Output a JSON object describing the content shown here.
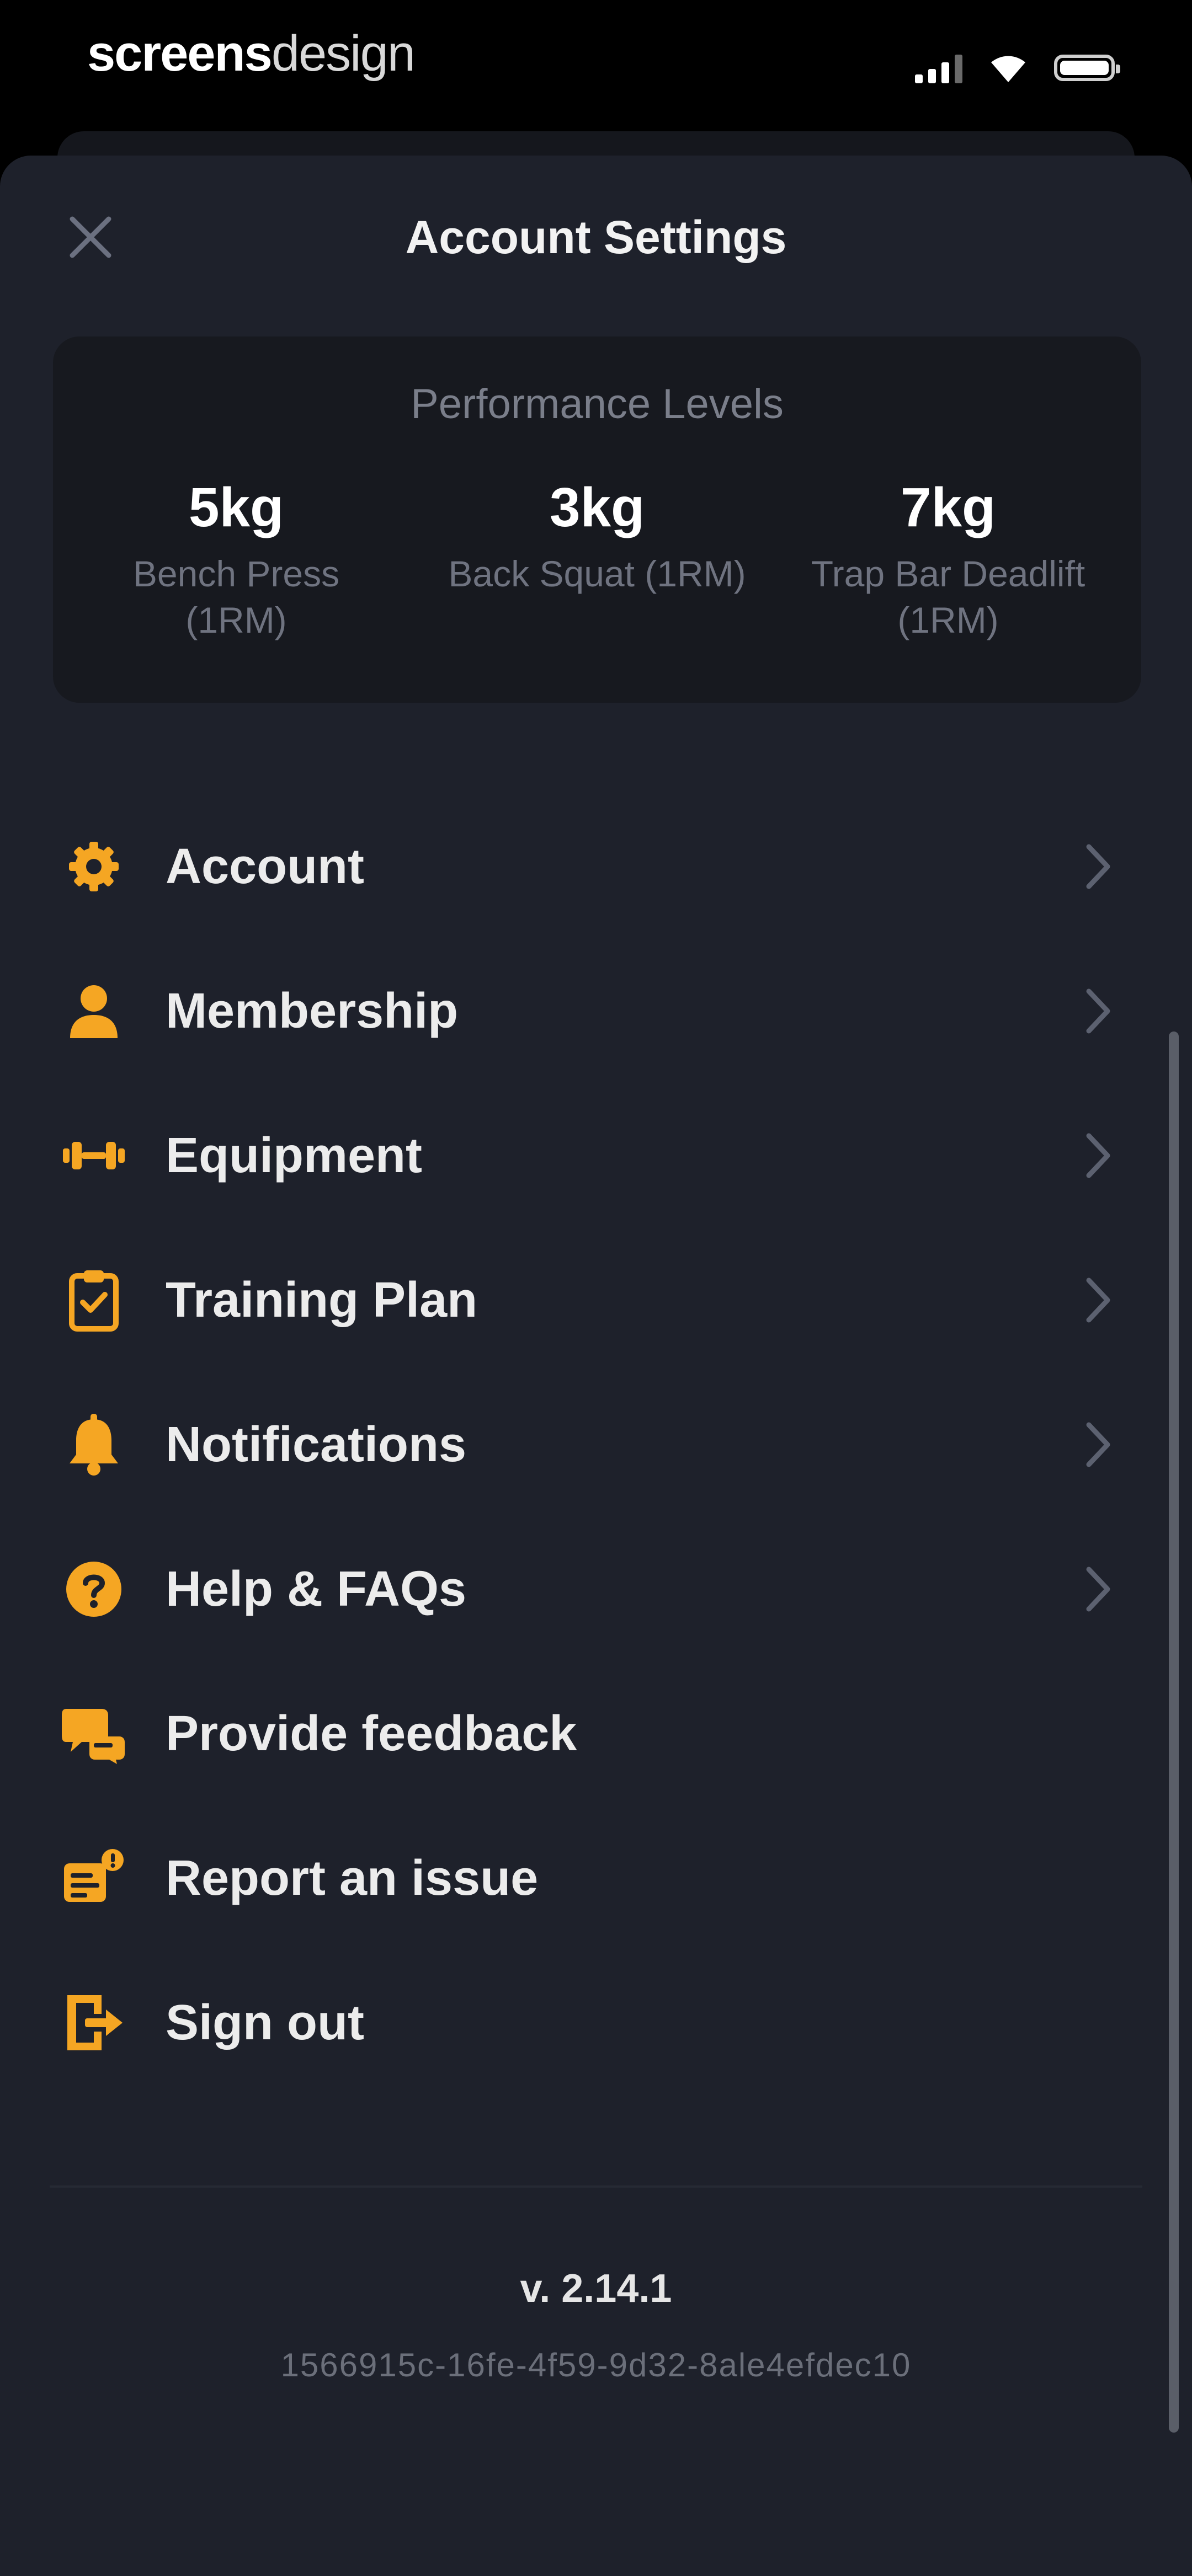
{
  "status_bar": {
    "brand_bold": "screens",
    "brand_light": "design"
  },
  "header": {
    "title": "Account Settings",
    "close_icon": "close-icon"
  },
  "performance": {
    "heading": "Performance Levels",
    "stats": [
      {
        "value": "5kg",
        "label_line1": "Bench Press",
        "label_line2": "(1RM)"
      },
      {
        "value": "3kg",
        "label_line1": "Back Squat (1RM)",
        "label_line2": ""
      },
      {
        "value": "7kg",
        "label_line1": "Trap Bar Deadlift",
        "label_line2": "(1RM)"
      }
    ]
  },
  "menu": {
    "items": [
      {
        "label": "Account",
        "icon": "gear-icon",
        "has_chevron": true
      },
      {
        "label": "Membership",
        "icon": "user-icon",
        "has_chevron": true
      },
      {
        "label": "Equipment",
        "icon": "dumbbell-icon",
        "has_chevron": true
      },
      {
        "label": "Training Plan",
        "icon": "clipboard-icon",
        "has_chevron": true
      },
      {
        "label": "Notifications",
        "icon": "bell-icon",
        "has_chevron": true
      },
      {
        "label": "Help & FAQs",
        "icon": "help-icon",
        "has_chevron": true
      },
      {
        "label": "Provide feedback",
        "icon": "feedback-icon",
        "has_chevron": false
      },
      {
        "label": "Report an issue",
        "icon": "report-icon",
        "has_chevron": false
      },
      {
        "label": "Sign out",
        "icon": "sign-out-icon",
        "has_chevron": false
      }
    ]
  },
  "footer": {
    "version": "v. 2.14.1",
    "build_id": "1566915c-16fe-4f59-9d32-8ale4efdec10"
  },
  "colors": {
    "accent": "#f5a623",
    "background": "#1e212b",
    "card": "#17191f",
    "chevron": "#5c6170"
  }
}
